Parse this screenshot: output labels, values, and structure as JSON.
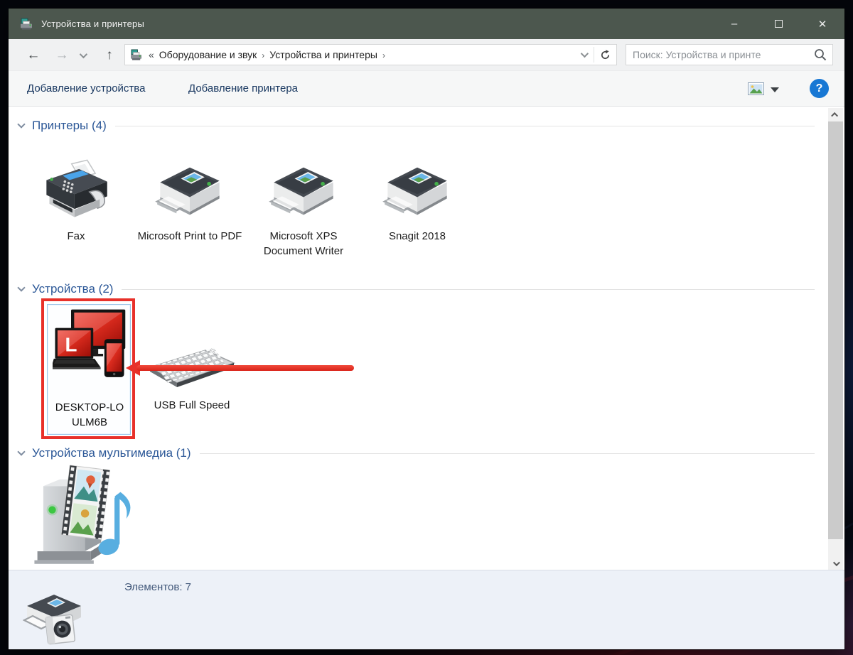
{
  "window": {
    "title": "Устройства и принтеры",
    "controls": {
      "minimize": "–",
      "close": "✕"
    }
  },
  "nav": {
    "back": "←",
    "forward": "→",
    "up": "↑",
    "breadcrumb": {
      "prefix": "«",
      "sep": "›",
      "crumbs": [
        {
          "label": "Оборудование и звук"
        },
        {
          "label": "Устройства и принтеры"
        }
      ]
    },
    "search_placeholder": "Поиск: Устройства и принте"
  },
  "toolbar": {
    "add_device": "Добавление устройства",
    "add_printer": "Добавление принтера",
    "help": "?"
  },
  "sections": {
    "printers": {
      "title": "Принтеры (4)",
      "items": [
        {
          "label": "Fax",
          "icon": "fax-machine"
        },
        {
          "label": "Microsoft Print to PDF",
          "icon": "printer"
        },
        {
          "label": "Microsoft XPS Document Writer",
          "icon": "printer"
        },
        {
          "label": "Snagit 2018",
          "icon": "printer"
        }
      ]
    },
    "devices": {
      "title": "Устройства (2)",
      "items": [
        {
          "label": "DESKTOP-LOULM6B",
          "icon": "multi-device-pc",
          "icon_letter": "L",
          "selected": true,
          "annotated": true
        },
        {
          "label": "USB Full Speed",
          "icon": "keyboard"
        }
      ]
    },
    "multimedia": {
      "title": "Устройства мультимедиа (1)",
      "items": [
        {
          "label": "",
          "icon": "media-server"
        }
      ]
    }
  },
  "statusbar": {
    "items_count": "Элементов: 7"
  },
  "annotation": {
    "color": "#e8312a",
    "shapes": [
      "highlight-box",
      "arrow-left"
    ]
  },
  "colors": {
    "titlebar": "#4c574e",
    "section_header_blue": "#2b5797",
    "command_text_blue": "#17365f",
    "help_blue": "#1878d4",
    "annotation_red": "#e8312a",
    "selection_border": "#9dc5e8",
    "details_bg": "#edf1f8"
  }
}
